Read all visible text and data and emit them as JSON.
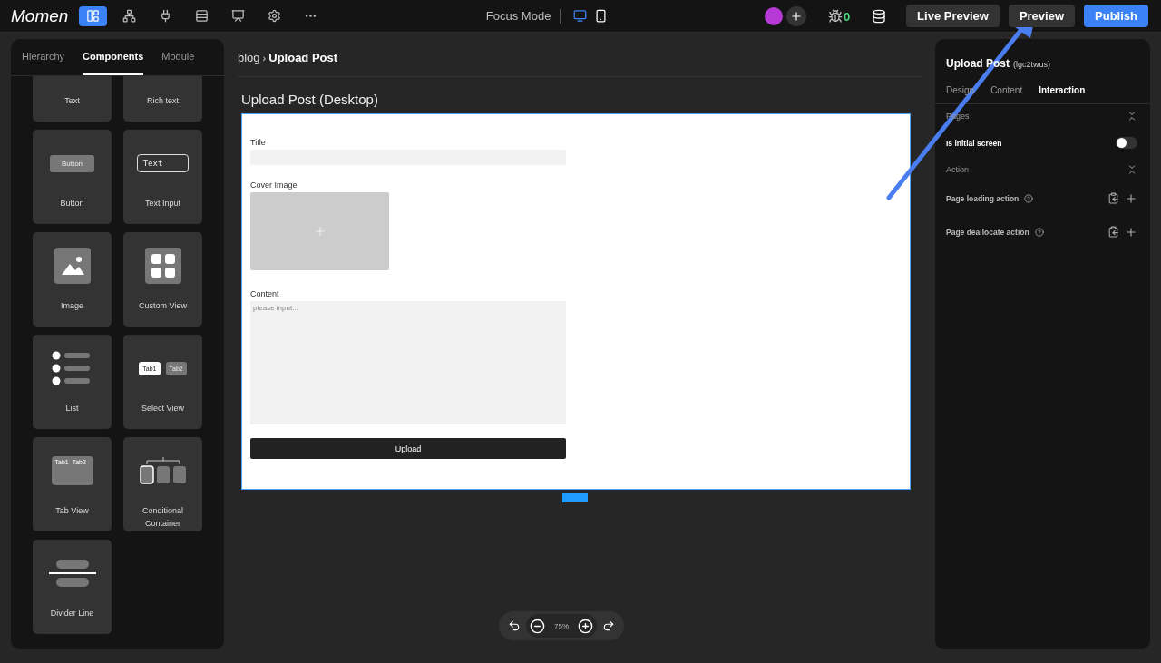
{
  "topbar": {
    "logo": "Momen",
    "tools": [
      {
        "kind": "pages",
        "selected": true
      },
      {
        "kind": "flow",
        "selected": false
      },
      {
        "kind": "plugin",
        "selected": false
      },
      {
        "kind": "layout",
        "selected": false
      },
      {
        "kind": "dashboard",
        "selected": false
      },
      {
        "kind": "settings",
        "selected": false
      },
      {
        "kind": "more",
        "selected": false
      }
    ],
    "focus_mode": "Focus Mode",
    "devices": [
      {
        "kind": "desktop",
        "selected": true
      },
      {
        "kind": "mobile",
        "selected": false
      }
    ],
    "bug_count": "0",
    "buttons": [
      {
        "label": "Live Preview",
        "kind": "secondary"
      },
      {
        "label": "Preview",
        "kind": "secondary"
      },
      {
        "label": "Publish",
        "kind": "primary"
      }
    ]
  },
  "left_panel": {
    "tabs": [
      {
        "label": "Hierarchy",
        "selected": false
      },
      {
        "label": "Components",
        "selected": true
      },
      {
        "label": "Module",
        "selected": false
      }
    ],
    "components": [
      {
        "kind": "text",
        "label": "Text"
      },
      {
        "kind": "rich_text",
        "label": "Rich text"
      },
      {
        "kind": "button",
        "label": "Button"
      },
      {
        "kind": "text_input",
        "label": "Text Input"
      },
      {
        "kind": "image",
        "label": "Image"
      },
      {
        "kind": "custom_view",
        "label": "Custom View"
      },
      {
        "kind": "list",
        "label": "List"
      },
      {
        "kind": "select_view",
        "label": "Select View"
      },
      {
        "kind": "tab_view",
        "label": "Tab View"
      },
      {
        "kind": "conditional",
        "label": "Conditional Container"
      },
      {
        "kind": "divider",
        "label": "Divider Line"
      }
    ],
    "preview_texts": {
      "button": [
        "Button"
      ],
      "text_input": [
        "Text"
      ],
      "select_view": [
        "Tab1",
        "Tab2"
      ],
      "tab_view": [
        "Tab1",
        "Tab2"
      ]
    }
  },
  "breadcrumb": {
    "items": [
      "blog",
      "Upload Post"
    ],
    "separator": "›"
  },
  "canvas": {
    "title": "Upload Post (Desktop)",
    "fields": [
      {
        "kind": "input",
        "label": "Title"
      },
      {
        "kind": "image",
        "label": "Cover Image"
      },
      {
        "kind": "textarea",
        "label": "Content",
        "placeholder": "please input..."
      }
    ],
    "button": "Upload"
  },
  "zoom": {
    "value": "75%"
  },
  "right_panel": {
    "title": "Upload Post",
    "id": "(lgc2twus)",
    "tabs": [
      {
        "label": "Design",
        "selected": false
      },
      {
        "label": "Content",
        "selected": false
      },
      {
        "label": "Interaction",
        "selected": true
      }
    ],
    "sections": [
      {
        "title": "Pages",
        "rows": [
          {
            "kind": "toggle",
            "label": "Is initial screen",
            "on": false
          }
        ]
      },
      {
        "title": "Action",
        "rows": [
          {
            "kind": "action",
            "label": "Page loading action"
          },
          {
            "kind": "action",
            "label": "Page deallocate action"
          }
        ]
      }
    ]
  }
}
